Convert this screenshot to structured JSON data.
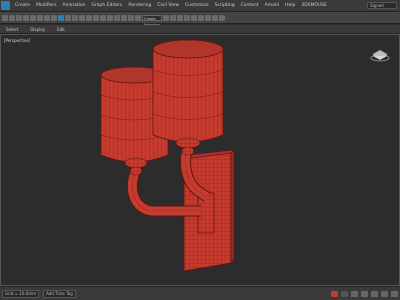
{
  "menubar": {
    "items": [
      "Create",
      "Modifiers",
      "Animation",
      "Graph Editors",
      "Rendering",
      "Civil View",
      "Customize",
      "Scripting",
      "Content",
      "Arnold",
      "Help",
      "3DSMOUSE"
    ],
    "search_text": "Signed"
  },
  "toolbar": {
    "selection_set": "Create Selection Set"
  },
  "ribbon": {
    "items": [
      "Select",
      "Display",
      "Edit"
    ]
  },
  "viewport": {
    "label": "[Perspective]",
    "accent_color": "#c43c30",
    "wire_color": "#7a1a14"
  },
  "status": {
    "coords": "Grid = 10.0mm",
    "addtime": "Add Time Tag"
  }
}
